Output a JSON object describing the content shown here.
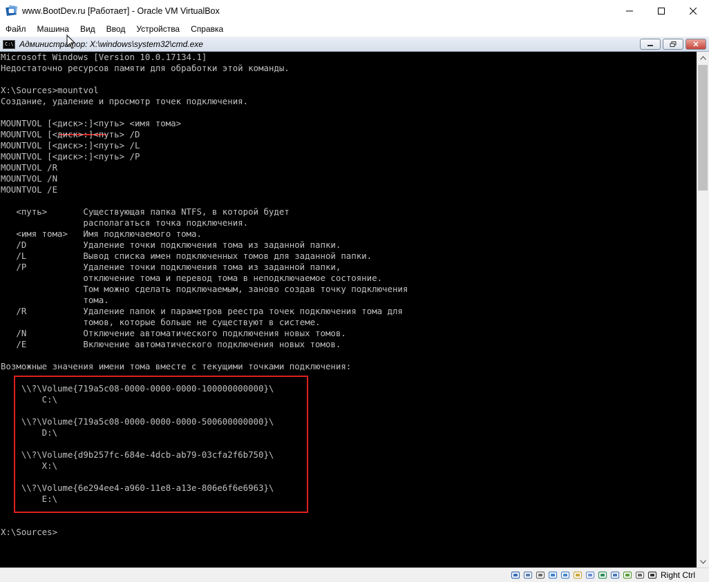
{
  "window": {
    "title": "www.BootDev.ru [Работает] - Oracle VM VirtualBox",
    "icon": "virtualbox-icon"
  },
  "menu": {
    "items": [
      "Файл",
      "Машина",
      "Вид",
      "Ввод",
      "Устройства",
      "Справка"
    ]
  },
  "cmd_window": {
    "title": "Администратор: X:\\windows\\system32\\cmd.exe",
    "icon_text": "C:\\"
  },
  "console": {
    "lines": [
      "Microsoft Windows [Version 10.0.17134.1]",
      "Недостаточно ресурсов памяти для обработки этой команды.",
      "",
      "X:\\Sources>mountvol",
      "Создание, удаление и просмотр точек подключения.",
      "",
      "MOUNTVOL [<диск>:]<путь> <имя тома>",
      "MOUNTVOL [<диск>:]<путь> /D",
      "MOUNTVOL [<диск>:]<путь> /L",
      "MOUNTVOL [<диск>:]<путь> /P",
      "MOUNTVOL /R",
      "MOUNTVOL /N",
      "MOUNTVOL /E",
      "",
      "   <путь>       Существующая папка NTFS, в которой будет",
      "                располагаться точка подключения.",
      "   <имя тома>   Имя подключаемого тома.",
      "   /D           Удаление точки подключения тома из заданной папки.",
      "   /L           Вывод списка имен подключенных томов для заданной папки.",
      "   /P           Удаление точки подключения тома из заданной папки,",
      "                отключение тома и перевод тома в неподключаемое состояние.",
      "                Том можно сделать подключаемым, заново создав точку подключения",
      "                тома.",
      "   /R           Удаление папок и параметров реестра точек подключения тома для",
      "                томов, которые больше не существуют в системе.",
      "   /N           Отключение автоматического подключения новых томов.",
      "   /E           Включение автоматического подключения новых томов.",
      "",
      "Возможные значения имени тома вместе с текущими точками подключения:",
      "",
      "    \\\\?\\Volume{719a5c08-0000-0000-0000-100000000000}\\",
      "        C:\\",
      "",
      "    \\\\?\\Volume{719a5c08-0000-0000-0000-500600000000}\\",
      "        D:\\",
      "",
      "    \\\\?\\Volume{d9b257fc-684e-4dcb-ab79-03cfa2f6b750}\\",
      "        X:\\",
      "",
      "    \\\\?\\Volume{6e294ee4-a960-11e8-a13e-806e6f6e6963}\\",
      "        E:\\",
      "",
      "",
      "X:\\Sources>"
    ]
  },
  "colors": {
    "console_bg": "#000000",
    "console_text": "#c0c0c0",
    "highlight": "#e02020"
  },
  "statusbar": {
    "host_key": "Right Ctrl",
    "icons": [
      "hdd-icon",
      "optical-drive-icon",
      "audio-icon",
      "network-icon",
      "usb-icon",
      "shared-folders-icon",
      "display-icon",
      "video-capture-icon",
      "cpu-icon",
      "virtualization-icon",
      "mouse-integration-icon",
      "keyboard-icon"
    ]
  }
}
